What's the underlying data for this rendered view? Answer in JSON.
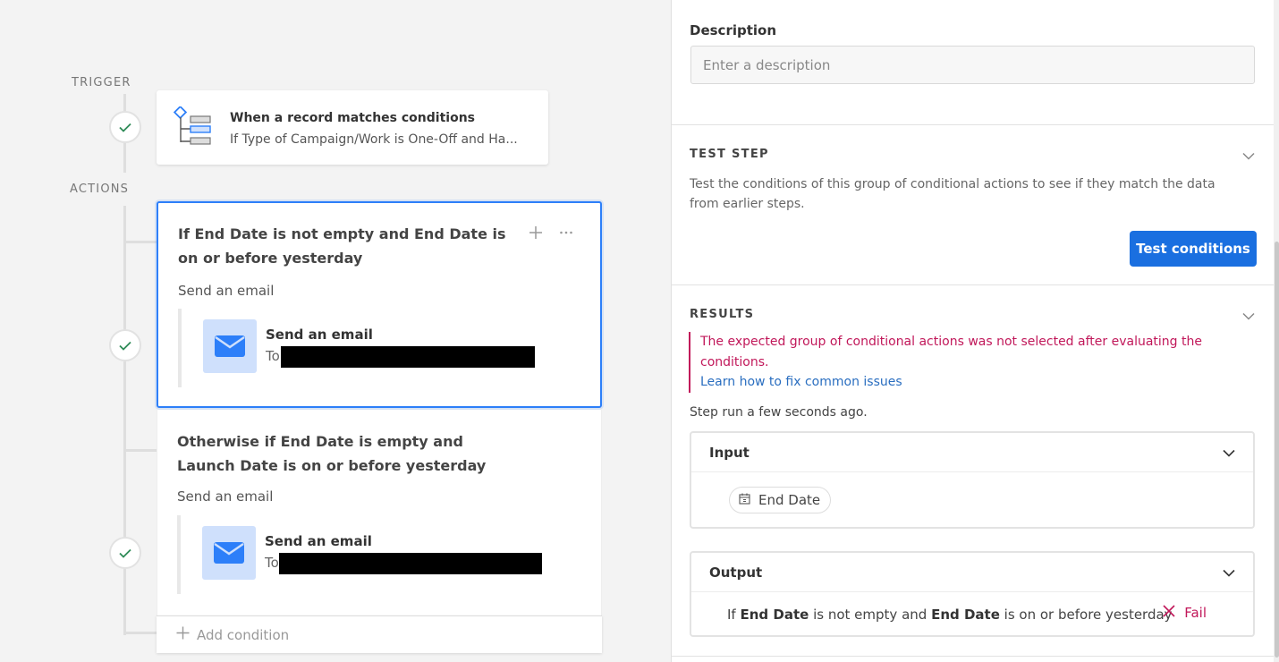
{
  "canvas": {
    "trigger_label": "TRIGGER",
    "actions_label": "ACTIONS",
    "trigger": {
      "title": "When a record matches conditions",
      "subtitle": "If Type of Campaign/Work is One-Off and Ha..."
    },
    "conditions": [
      {
        "title": "If End Date is not empty and End Date is on or before yesterday",
        "subtitle": "Send an email",
        "email_title": "Send an email",
        "email_to": "To"
      },
      {
        "title": "Otherwise if End Date is empty and Launch Date is on or before yesterday",
        "subtitle": "Send an email",
        "email_title": "Send an email",
        "email_to": "To"
      }
    ],
    "add_condition": "Add condition"
  },
  "panel": {
    "description": {
      "label": "Description",
      "placeholder": "Enter a description"
    },
    "test_step": {
      "heading": "TEST STEP",
      "text": "Test the conditions of this group of conditional actions to see if they match the data from earlier steps.",
      "button": "Test conditions"
    },
    "results": {
      "heading": "RESULTS",
      "error": "The expected group of conditional actions was not selected after evaluating the conditions.",
      "link": "Learn how to fix common issues",
      "run_status": "Step run a few seconds ago.",
      "input": {
        "title": "Input",
        "field": "End Date"
      },
      "output": {
        "title": "Output",
        "row_prefix": "If",
        "row_field1": "End Date",
        "row_mid": "is not empty and",
        "row_field2": "End Date",
        "row_suffix": "is on or before yesterday",
        "status": "Fail"
      }
    }
  },
  "colors": {
    "accent": "#2d7ff9",
    "button": "#1a6fe0",
    "error": "#c1185a",
    "link": "#2a6ec0",
    "check": "#2e8b57"
  }
}
